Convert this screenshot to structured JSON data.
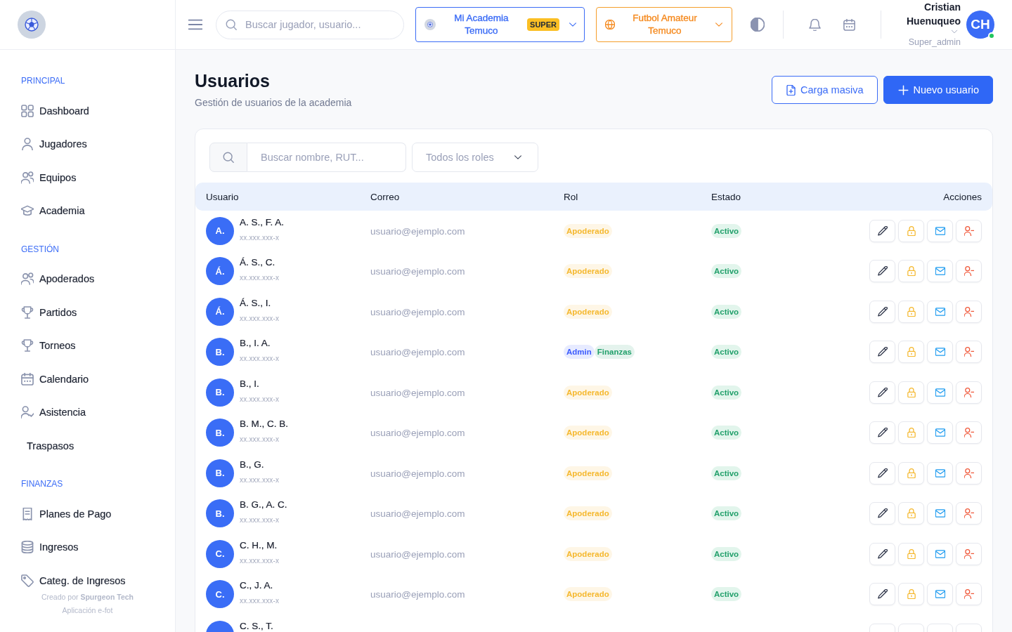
{
  "sidebar": {
    "sections": [
      {
        "title": "PRINCIPAL",
        "items": [
          {
            "label": "Dashboard",
            "selected": false
          },
          {
            "label": "Jugadores",
            "selected": false
          },
          {
            "label": "Equipos",
            "selected": false
          },
          {
            "label": "Academia",
            "selected": false
          }
        ]
      },
      {
        "title": "GESTIÓN",
        "items": [
          {
            "label": "Apoderados",
            "selected": false
          },
          {
            "label": "Partidos",
            "selected": false
          },
          {
            "label": "Torneos",
            "selected": false
          },
          {
            "label": "Calendario",
            "selected": false
          },
          {
            "label": "Asistencia",
            "selected": false
          },
          {
            "label": "Traspasos",
            "selected": false
          }
        ]
      },
      {
        "title": "FINANZAS",
        "items": [
          {
            "label": "Planes de Pago",
            "selected": false
          },
          {
            "label": "Ingresos",
            "selected": false
          },
          {
            "label": "Categ. de Ingresos",
            "selected": false
          }
        ]
      }
    ],
    "footer": {
      "credit": "Creado por **Spurgeon Tech**",
      "app": "Aplicación e-fot"
    }
  },
  "topbar": {
    "search": {
      "placeholder": "Buscar jugador, usuario..."
    },
    "academy": {
      "name": "Mi Academia Temuco",
      "badge": "SUPER"
    },
    "league": {
      "name": "Futbol Amateur Temuco"
    },
    "user": {
      "name": "Cristian Huenuqueo",
      "role": "Super_admin",
      "initials": "CH",
      "online": true
    }
  },
  "page": {
    "title": "Usuarios",
    "subtitle": "Gestión de usuarios de la academia",
    "buttons": [
      {
        "label": "Carga masiva",
        "kind": "outline"
      },
      {
        "label": "Nuevo usuario",
        "kind": "primary"
      }
    ]
  },
  "filters": {
    "search": {
      "placeholder": "Buscar nombre, RUT..."
    },
    "role_filter": {
      "value": "Todos los roles"
    }
  },
  "table": {
    "columns": [
      "Usuario",
      "Correo",
      "Rol",
      "Estado",
      "Acciones"
    ],
    "rows": [
      {
        "initial": "A.",
        "name": "A. S., F. A.",
        "rut": "xx.xxx.xxx-x",
        "email": "usuario@ejemplo.com",
        "roles": [
          {
            "label": "Apoderado",
            "color": "#f5b82e"
          }
        ],
        "status": {
          "label": "Activo",
          "active": true
        }
      },
      {
        "initial": "Á.",
        "name": "Á. S., C.",
        "rut": "xx.xxx.xxx-x",
        "email": "usuario@ejemplo.com",
        "roles": [
          {
            "label": "Apoderado",
            "color": "#f5b82e"
          }
        ],
        "status": {
          "label": "Activo",
          "active": true
        }
      },
      {
        "initial": "Á.",
        "name": "Á. S., I.",
        "rut": "xx.xxx.xxx-x",
        "email": "usuario@ejemplo.com",
        "roles": [
          {
            "label": "Apoderado",
            "color": "#f5b82e"
          }
        ],
        "status": {
          "label": "Activo",
          "active": true
        }
      },
      {
        "initial": "B.",
        "name": "B., I. A.",
        "rut": "xx.xxx.xxx-x",
        "email": "usuario@ejemplo.com",
        "roles": [
          {
            "label": "Admin",
            "color": "#3b5bfd"
          },
          {
            "label": "Finanzas",
            "color": "#22a06b"
          }
        ],
        "status": {
          "label": "Activo",
          "active": true
        }
      },
      {
        "initial": "B.",
        "name": "B., I.",
        "rut": "xx.xxx.xxx-x",
        "email": "usuario@ejemplo.com",
        "roles": [
          {
            "label": "Apoderado",
            "color": "#f5b82e"
          }
        ],
        "status": {
          "label": "Activo",
          "active": true
        }
      },
      {
        "initial": "B.",
        "name": "B. M., C. B.",
        "rut": "xx.xxx.xxx-x",
        "email": "usuario@ejemplo.com",
        "roles": [
          {
            "label": "Apoderado",
            "color": "#f5b82e"
          }
        ],
        "status": {
          "label": "Activo",
          "active": true
        }
      },
      {
        "initial": "B.",
        "name": "B., G.",
        "rut": "xx.xxx.xxx-x",
        "email": "usuario@ejemplo.com",
        "roles": [
          {
            "label": "Apoderado",
            "color": "#f5b82e"
          }
        ],
        "status": {
          "label": "Activo",
          "active": true
        }
      },
      {
        "initial": "B.",
        "name": "B. G., A. C.",
        "rut": "xx.xxx.xxx-x",
        "email": "usuario@ejemplo.com",
        "roles": [
          {
            "label": "Apoderado",
            "color": "#f5b82e"
          }
        ],
        "status": {
          "label": "Activo",
          "active": true
        }
      },
      {
        "initial": "C.",
        "name": "C. H., M.",
        "rut": "xx.xxx.xxx-x",
        "email": "usuario@ejemplo.com",
        "roles": [
          {
            "label": "Apoderado",
            "color": "#f5b82e"
          }
        ],
        "status": {
          "label": "Activo",
          "active": true
        }
      },
      {
        "initial": "C.",
        "name": "C., J. A.",
        "rut": "xx.xxx.xxx-x",
        "email": "usuario@ejemplo.com",
        "roles": [
          {
            "label": "Apoderado",
            "color": "#f5b82e"
          }
        ],
        "status": {
          "label": "Activo",
          "active": true
        }
      },
      {
        "name": "C. S., T."
      }
    ]
  }
}
